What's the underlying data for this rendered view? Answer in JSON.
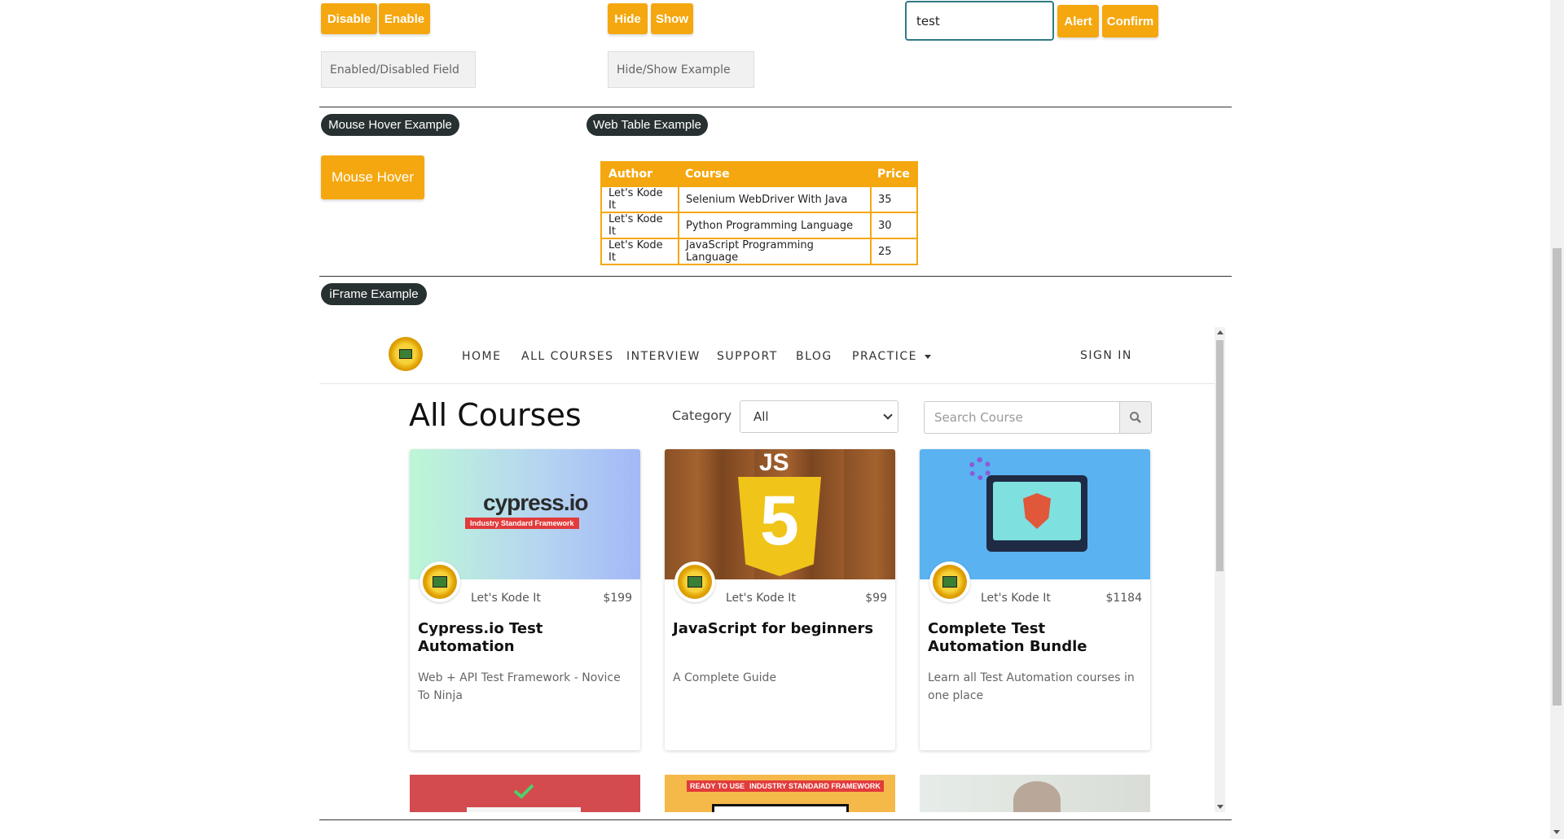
{
  "top_controls": {
    "disable_label": "Disable",
    "enable_label": "Enable",
    "enabled_field_placeholder": "Enabled/Disabled Field",
    "hide_label": "Hide",
    "show_label": "Show",
    "hide_show_placeholder": "Hide/Show Example",
    "name_input_value": "test",
    "alert_label": "Alert",
    "confirm_label": "Confirm"
  },
  "sections": {
    "mouse_hover_title": "Mouse Hover Example",
    "mouse_hover_button": "Mouse Hover",
    "web_table_title": "Web Table Example",
    "iframe_title": "iFrame Example"
  },
  "web_table": {
    "headers": [
      "Author",
      "Course",
      "Price"
    ],
    "rows": [
      [
        "Let's Kode It",
        "Selenium WebDriver With Java",
        "35"
      ],
      [
        "Let's Kode It",
        "Python Programming Language",
        "30"
      ],
      [
        "Let's Kode It",
        "JavaScript Programming Language",
        "25"
      ]
    ]
  },
  "iframe": {
    "nav": [
      "HOME",
      "ALL COURSES",
      "INTERVIEW",
      "SUPPORT",
      "BLOG",
      "PRACTICE",
      "SIGN IN"
    ],
    "heading": "All Courses",
    "category_label": "Category",
    "category_value": "All",
    "search_placeholder": "Search Course",
    "cards": [
      {
        "author": "Let's Kode It",
        "price": "$199",
        "title": "Cypress.io Test Automation",
        "desc": "Web + API Test Framework - Novice To Ninja",
        "img_text": "cypress.io",
        "img_sub": "Industry Standard Framework"
      },
      {
        "author": "Let's Kode It",
        "price": "$99",
        "title": "JavaScript for beginners",
        "desc": "A Complete Guide",
        "img_text": "JS"
      },
      {
        "author": "Let's Kode It",
        "price": "$1184",
        "title": "Complete Test Automation Bundle",
        "desc": "Learn all Test Automation courses in one place"
      }
    ],
    "mini_banner_text": "READY TO USE",
    "mini_banner_text2": "INDUSTRY STANDARD FRAMEWORK"
  },
  "colors": {
    "accent": "#f5a70f",
    "pill_bg": "#283132",
    "input_border": "#2e7b86"
  }
}
